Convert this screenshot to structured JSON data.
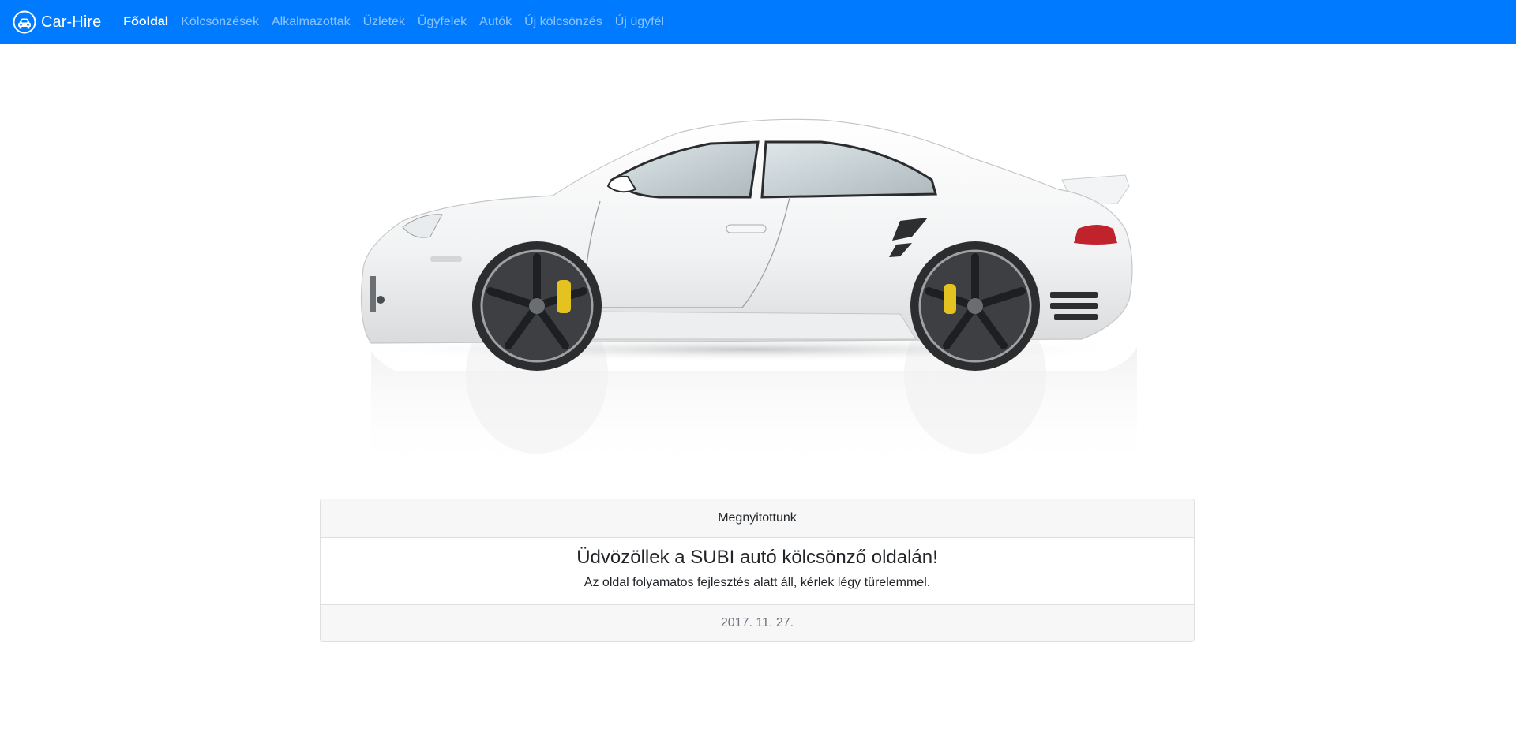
{
  "navbar": {
    "brand": "Car-Hire",
    "brand_icon": "car-logo-icon",
    "items": [
      {
        "label": "Főoldal",
        "active": true
      },
      {
        "label": "Kölcsönzések",
        "active": false
      },
      {
        "label": "Alkalmazottak",
        "active": false
      },
      {
        "label": "Üzletek",
        "active": false
      },
      {
        "label": "Ügyfelek",
        "active": false
      },
      {
        "label": "Autók",
        "active": false
      },
      {
        "label": "Új kölcsönzés",
        "active": false
      },
      {
        "label": "Új ügyfél",
        "active": false
      }
    ]
  },
  "hero": {
    "image": "white-sports-car-image"
  },
  "card": {
    "header": "Megnyitottunk",
    "title": "Üdvözöllek a SUBI autó kölcsönző oldalán!",
    "text": "Az oldal folyamatos fejlesztés alatt áll, kérlek légy türelemmel.",
    "footer": "2017. 11. 27."
  },
  "colors": {
    "navbar_bg": "#007bff",
    "card_header_bg": "#f7f7f7",
    "card_border": "#dfdfdf",
    "muted_text": "#6c757d"
  }
}
